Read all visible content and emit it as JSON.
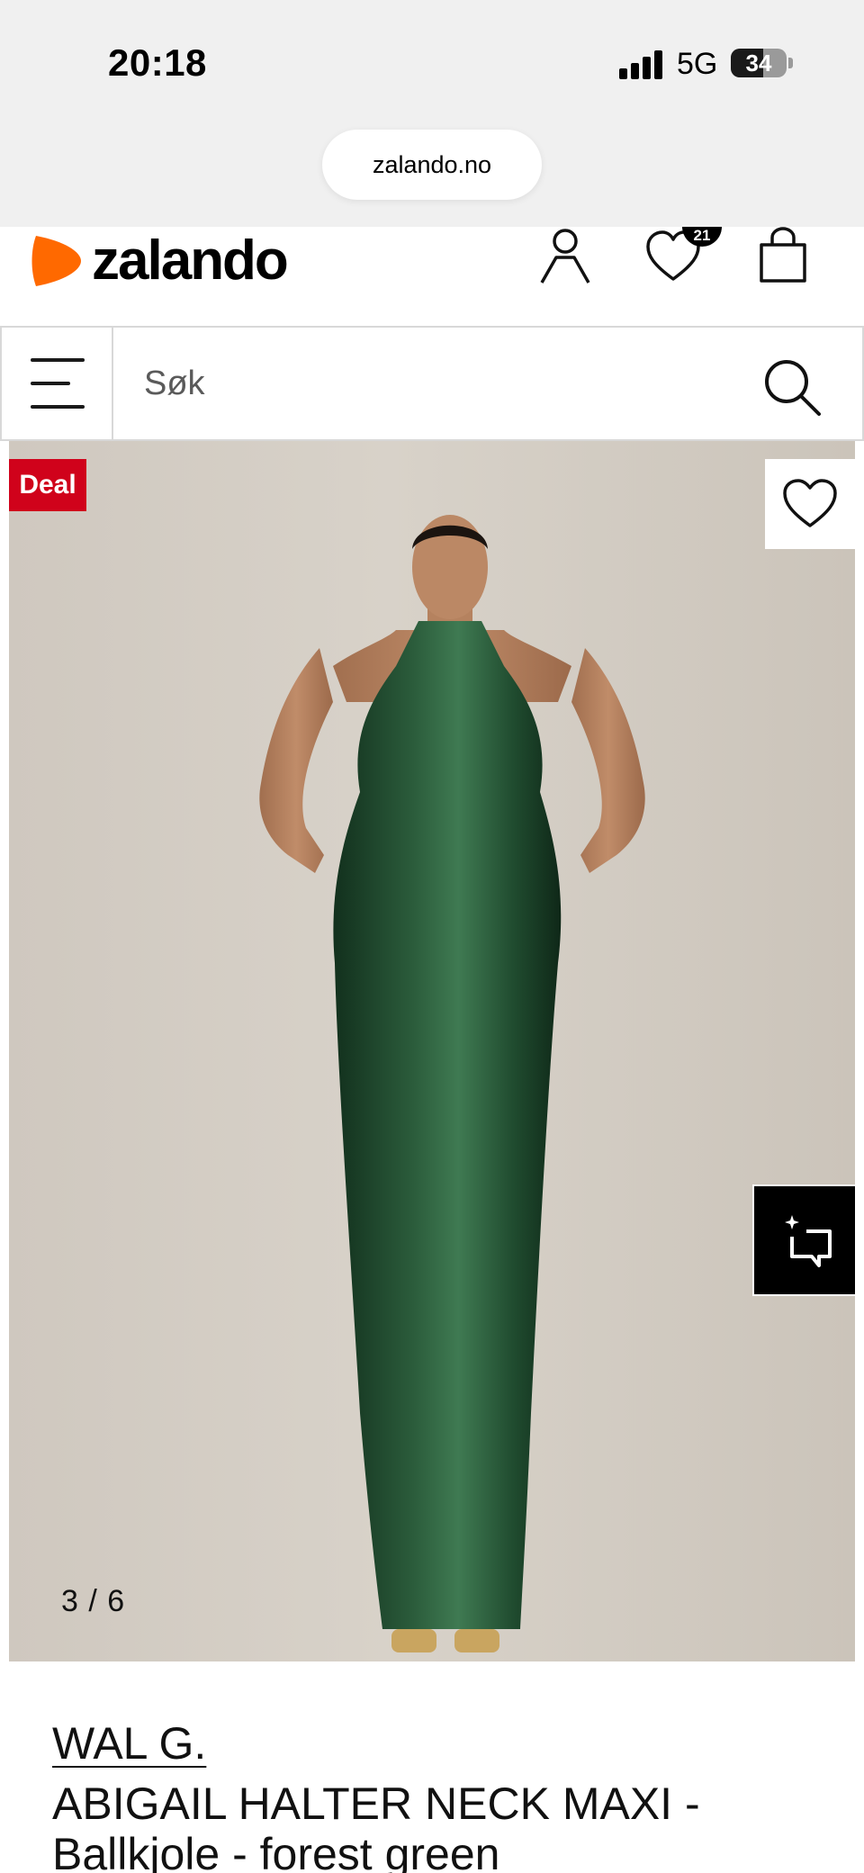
{
  "status_bar": {
    "time": "20:18",
    "network": "5G",
    "battery": "34"
  },
  "browser": {
    "url": "zalando.no"
  },
  "header": {
    "logo_text": "zalando",
    "wishlist_count": "21"
  },
  "search": {
    "placeholder": "Søk"
  },
  "gallery": {
    "deal_label": "Deal",
    "counter": "3 / 6",
    "current_index": 3,
    "total_images": 6
  },
  "product": {
    "brand": "WAL G.",
    "name": "ABIGAIL HALTER NECK MAXI - Ballkjole - forest green"
  },
  "colors": {
    "brand_orange": "#ff6900",
    "deal_red": "#d0021b",
    "dress_green": "#1f4a2e"
  },
  "icons": [
    "account-icon",
    "heart-icon",
    "bag-icon",
    "menu-icon",
    "search-icon",
    "wishlist-heart-icon",
    "ai-assistant-icon"
  ]
}
